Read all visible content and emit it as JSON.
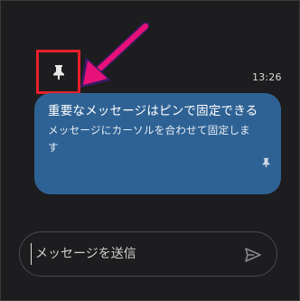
{
  "message": {
    "time": "13:26",
    "title": "重要なメッセージはピンで固定できる",
    "body": "メッセージにカーソルを合わせて固定します",
    "pinned": true
  },
  "composer": {
    "placeholder": "メッセージを送信"
  },
  "icons": {
    "pin_toolbar": "pin-icon",
    "pin_in_message": "pin-icon",
    "send": "send-icon",
    "annotation_arrow": "arrow-icon"
  },
  "colors": {
    "background": "#1d1d1f",
    "bubble": "#2f6294",
    "highlight_box": "#e8202a",
    "annotation_arrow": "#e8117a"
  }
}
